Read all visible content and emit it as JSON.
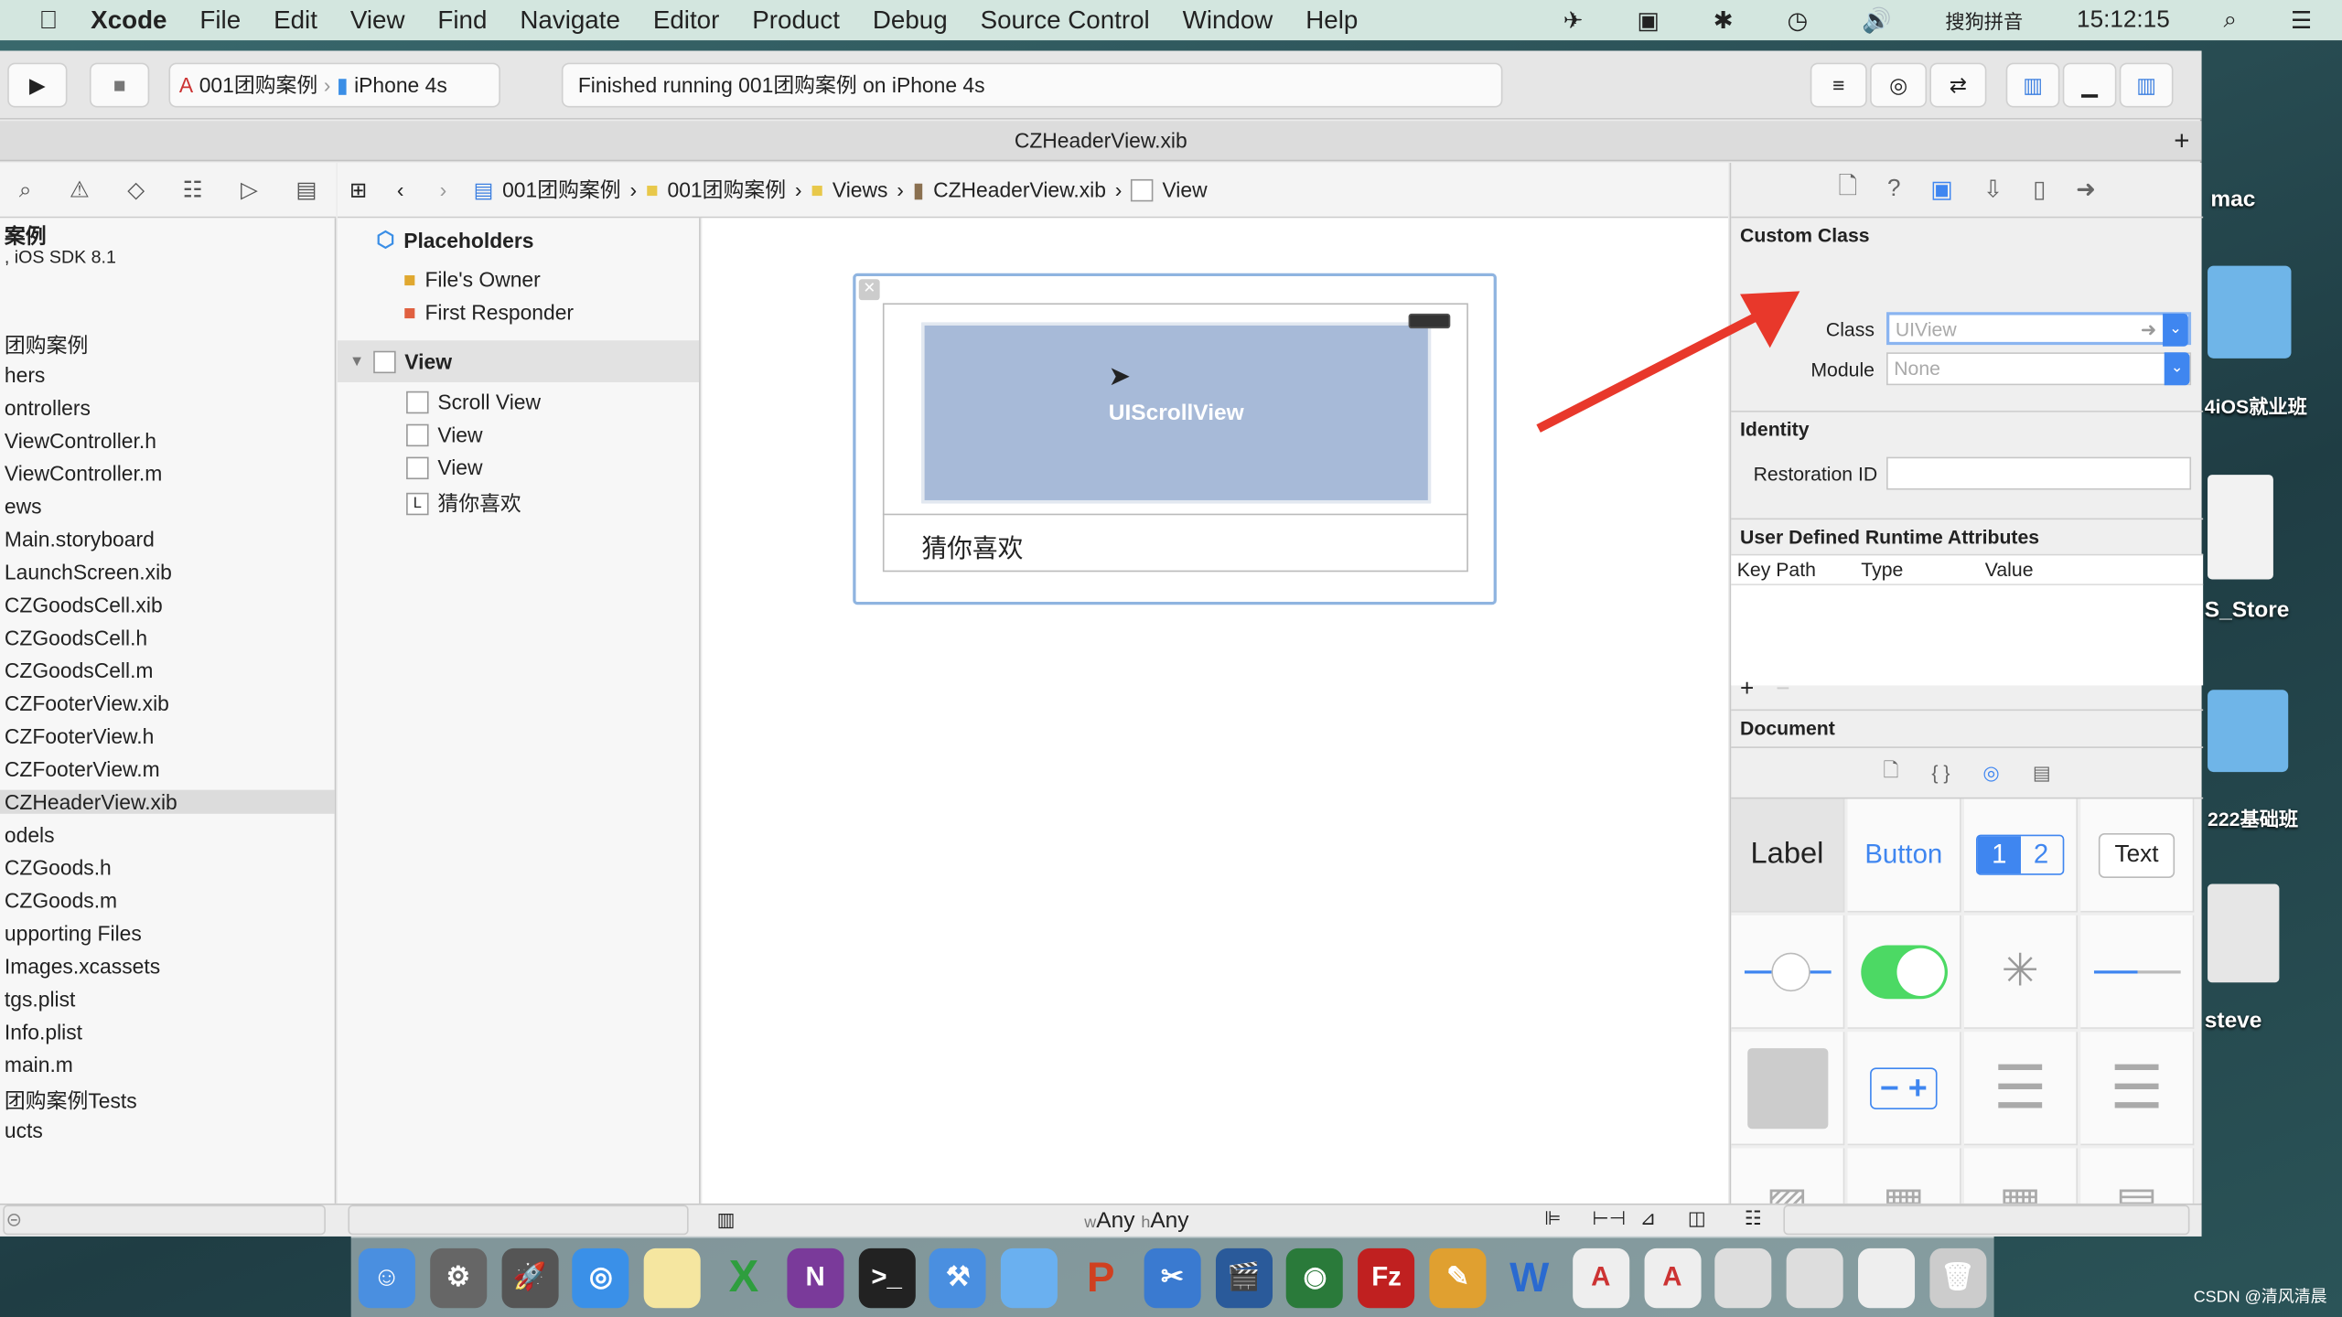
{
  "menubar": {
    "app": "Xcode",
    "items": [
      "File",
      "Edit",
      "View",
      "Find",
      "Navigate",
      "Editor",
      "Product",
      "Debug",
      "Source Control",
      "Window",
      "Help"
    ],
    "input_method": "搜狗拼音",
    "time": "15:12:15"
  },
  "toolbar": {
    "scheme": "001团购案例",
    "device": "iPhone 4s",
    "status": "Finished running 001团购案例 on iPhone 4s"
  },
  "tab": {
    "title": "CZHeaderView.xib"
  },
  "jumpbar": [
    "001团购案例",
    "001团购案例",
    "Views",
    "CZHeaderView.xib",
    "View"
  ],
  "navigator": {
    "header": "案例",
    "sdk": ", iOS SDK 8.1",
    "items": [
      "团购案例",
      "hers",
      "ontrollers",
      "ViewController.h",
      "ViewController.m",
      "ews",
      "Main.storyboard",
      "LaunchScreen.xib",
      "CZGoodsCell.xib",
      "CZGoodsCell.h",
      "CZGoodsCell.m",
      "CZFooterView.xib",
      "CZFooterView.h",
      "CZFooterView.m",
      "CZHeaderView.xib",
      "odels",
      "CZGoods.h",
      "CZGoods.m",
      "upporting Files",
      "Images.xcassets",
      "tgs.plist",
      "Info.plist",
      "main.m",
      "团购案例Tests",
      "ucts"
    ],
    "selected": "CZHeaderView.xib"
  },
  "outline": {
    "placeholders": "Placeholders",
    "files_owner": "File's Owner",
    "first_responder": "First Responder",
    "view": "View",
    "children": [
      "Scroll View",
      "View",
      "View",
      "猜你喜欢"
    ]
  },
  "canvas": {
    "scrollview_label": "UIScrollView",
    "label_text": "猜你喜欢",
    "size_class_w": "Any",
    "size_class_h": "Any",
    "w_prefix": "w",
    "h_prefix": "h"
  },
  "inspector": {
    "custom_class": "Custom Class",
    "class_label": "Class",
    "class_placeholder": "UIView",
    "module_label": "Module",
    "module_placeholder": "None",
    "identity": "Identity",
    "restoration_label": "Restoration ID",
    "runtime_attrs": "User Defined Runtime Attributes",
    "cols": [
      "Key Path",
      "Type",
      "Value"
    ],
    "document": "Document",
    "library": {
      "label": "Label",
      "button": "Button",
      "seg1": "1",
      "seg2": "2",
      "text": "Text"
    },
    "accent": "#3f86f0"
  },
  "desktop": {
    "icons": [
      "mac",
      "4iOS就业班",
      "S_Store",
      "222基础班",
      "steve"
    ]
  },
  "watermark": "CSDN @清风清晨",
  "annotation_color": "#e8382b"
}
